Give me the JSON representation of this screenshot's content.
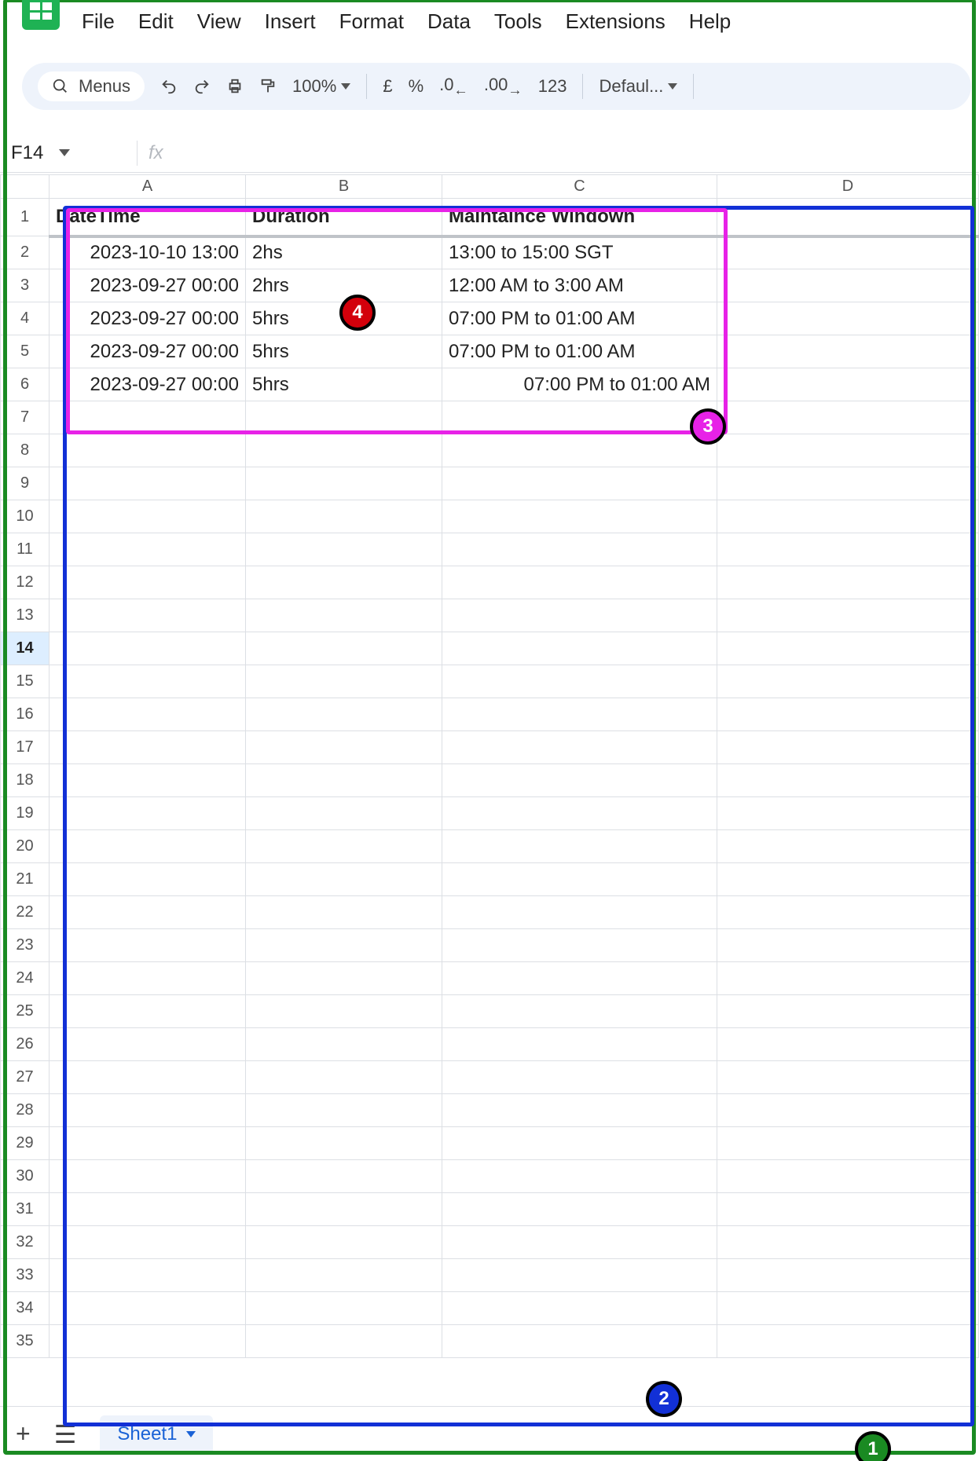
{
  "menus": {
    "file": "File",
    "edit": "Edit",
    "view": "View",
    "insert": "Insert",
    "format": "Format",
    "data": "Data",
    "tools": "Tools",
    "extensions": "Extensions",
    "help": "Help"
  },
  "toolbar": {
    "menus_label": "Menus",
    "zoom": "100%",
    "currency": "£",
    "percent": "%",
    "dec_minus": ".0",
    "dec_plus": ".00",
    "num_fmt": "123",
    "font": "Defaul..."
  },
  "name_box": "F14",
  "formula_bar": "",
  "fx_label": "fx",
  "columns": [
    "A",
    "B",
    "C",
    "D"
  ],
  "rows": {
    "count": 35,
    "active": 14,
    "header": [
      "DateTime",
      "Duration",
      "Maintaince Windown"
    ],
    "data": [
      [
        "2023-10-10 13:00",
        "2hs",
        "13:00 to 15:00 SGT"
      ],
      [
        "2023-09-27 00:00",
        "2hrs",
        "12:00 AM to 3:00 AM"
      ],
      [
        "2023-09-27 00:00",
        "5hrs",
        "07:00 PM to 01:00 AM"
      ],
      [
        "2023-09-27 00:00",
        "5hrs",
        "07:00 PM to 01:00 AM"
      ],
      [
        "2023-09-27 00:00",
        "5hrs",
        "07:00 PM to 01:00 AM"
      ]
    ]
  },
  "footer": {
    "tab": "Sheet1"
  },
  "annotations": {
    "badge1": "1",
    "badge2": "2",
    "badge3": "3",
    "badge4": "4"
  }
}
